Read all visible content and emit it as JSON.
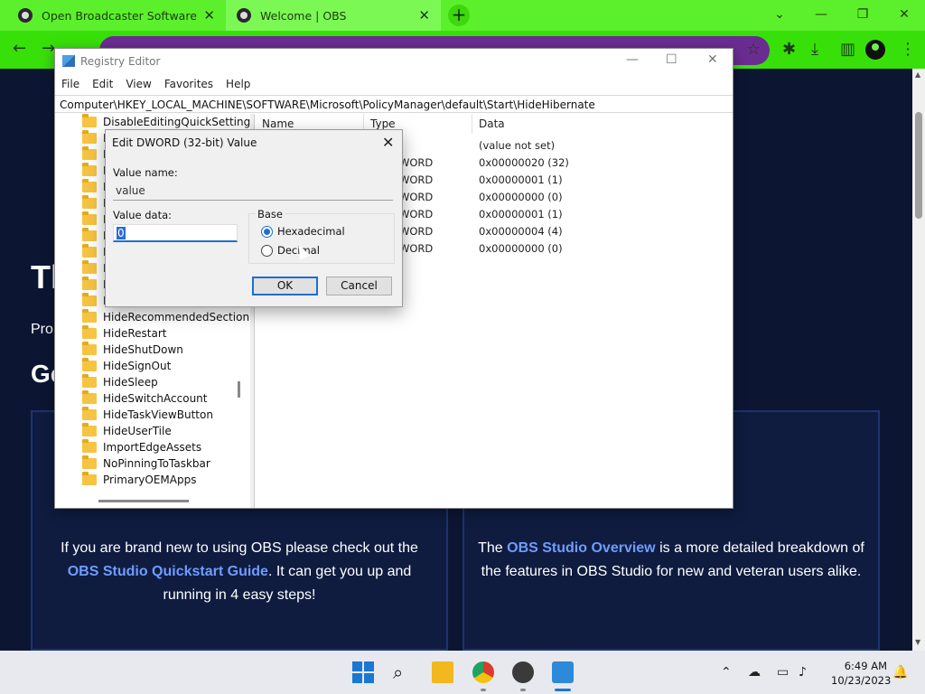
{
  "browser": {
    "tabs": [
      {
        "title": "Open Broadcaster Software | OBS",
        "close": "✕"
      },
      {
        "title": "Welcome | OBS",
        "close": "✕"
      }
    ],
    "new_tab": "+",
    "window_controls": [
      "⌄",
      "—",
      "❐",
      "✕"
    ]
  },
  "page": {
    "heading_fragment": "Tl",
    "pro_fragment": "Pro",
    "ge_fragment": "Ge",
    "card_left": {
      "pre": "If you are brand new to using OBS please check out the ",
      "link": "OBS Studio Quickstart Guide",
      "post": ". It can get you up and running in 4 easy steps!"
    },
    "card_right": {
      "pre": "The ",
      "link": "OBS Studio Overview",
      "post": " is a more detailed breakdown of the features in OBS Studio for new and veteran users alike."
    }
  },
  "regedit": {
    "title": "Registry Editor",
    "menu": [
      "File",
      "Edit",
      "View",
      "Favorites",
      "Help"
    ],
    "address": "Computer\\HKEY_LOCAL_MACHINE\\SOFTWARE\\Microsoft\\PolicyManager\\default\\Start\\HideHibernate",
    "tree": [
      "DisableEditingQuickSetting",
      "H",
      "H",
      "H",
      "H",
      "H",
      "H",
      "H",
      "H",
      "H",
      "H",
      "H",
      "HideRecommendedSection",
      "HideRestart",
      "HideShutDown",
      "HideSignOut",
      "HideSleep",
      "HideSwitchAccount",
      "HideTaskViewButton",
      "HideUserTile",
      "ImportEdgeAssets",
      "NoPinningToTaskbar",
      "PrimaryOEMApps"
    ],
    "columns": {
      "name": "Name",
      "type": "Type",
      "data": "Data"
    },
    "rows": [
      {
        "type": "",
        "data": "(value not set)"
      },
      {
        "type": "WORD",
        "data": "0x00000020 (32)"
      },
      {
        "type": "WORD",
        "data": "0x00000001 (1)"
      },
      {
        "type": "WORD",
        "data": "0x00000000 (0)"
      },
      {
        "type": "WORD",
        "data": "0x00000001 (1)"
      },
      {
        "type": "WORD",
        "data": "0x00000004 (4)"
      },
      {
        "type": "WORD",
        "data": "0x00000000 (0)"
      }
    ]
  },
  "dialog": {
    "title": "Edit DWORD (32-bit) Value",
    "value_name_label": "Value name:",
    "value_name": "value",
    "value_data_label": "Value data:",
    "value_data": "0",
    "base_label": "Base",
    "base_options": [
      {
        "label": "Hexadecimal",
        "selected": true
      },
      {
        "label": "Decimal",
        "selected": false
      }
    ],
    "ok": "OK",
    "cancel": "Cancel"
  },
  "taskbar": {
    "time": "6:49 AM",
    "date": "10/23/2023"
  }
}
